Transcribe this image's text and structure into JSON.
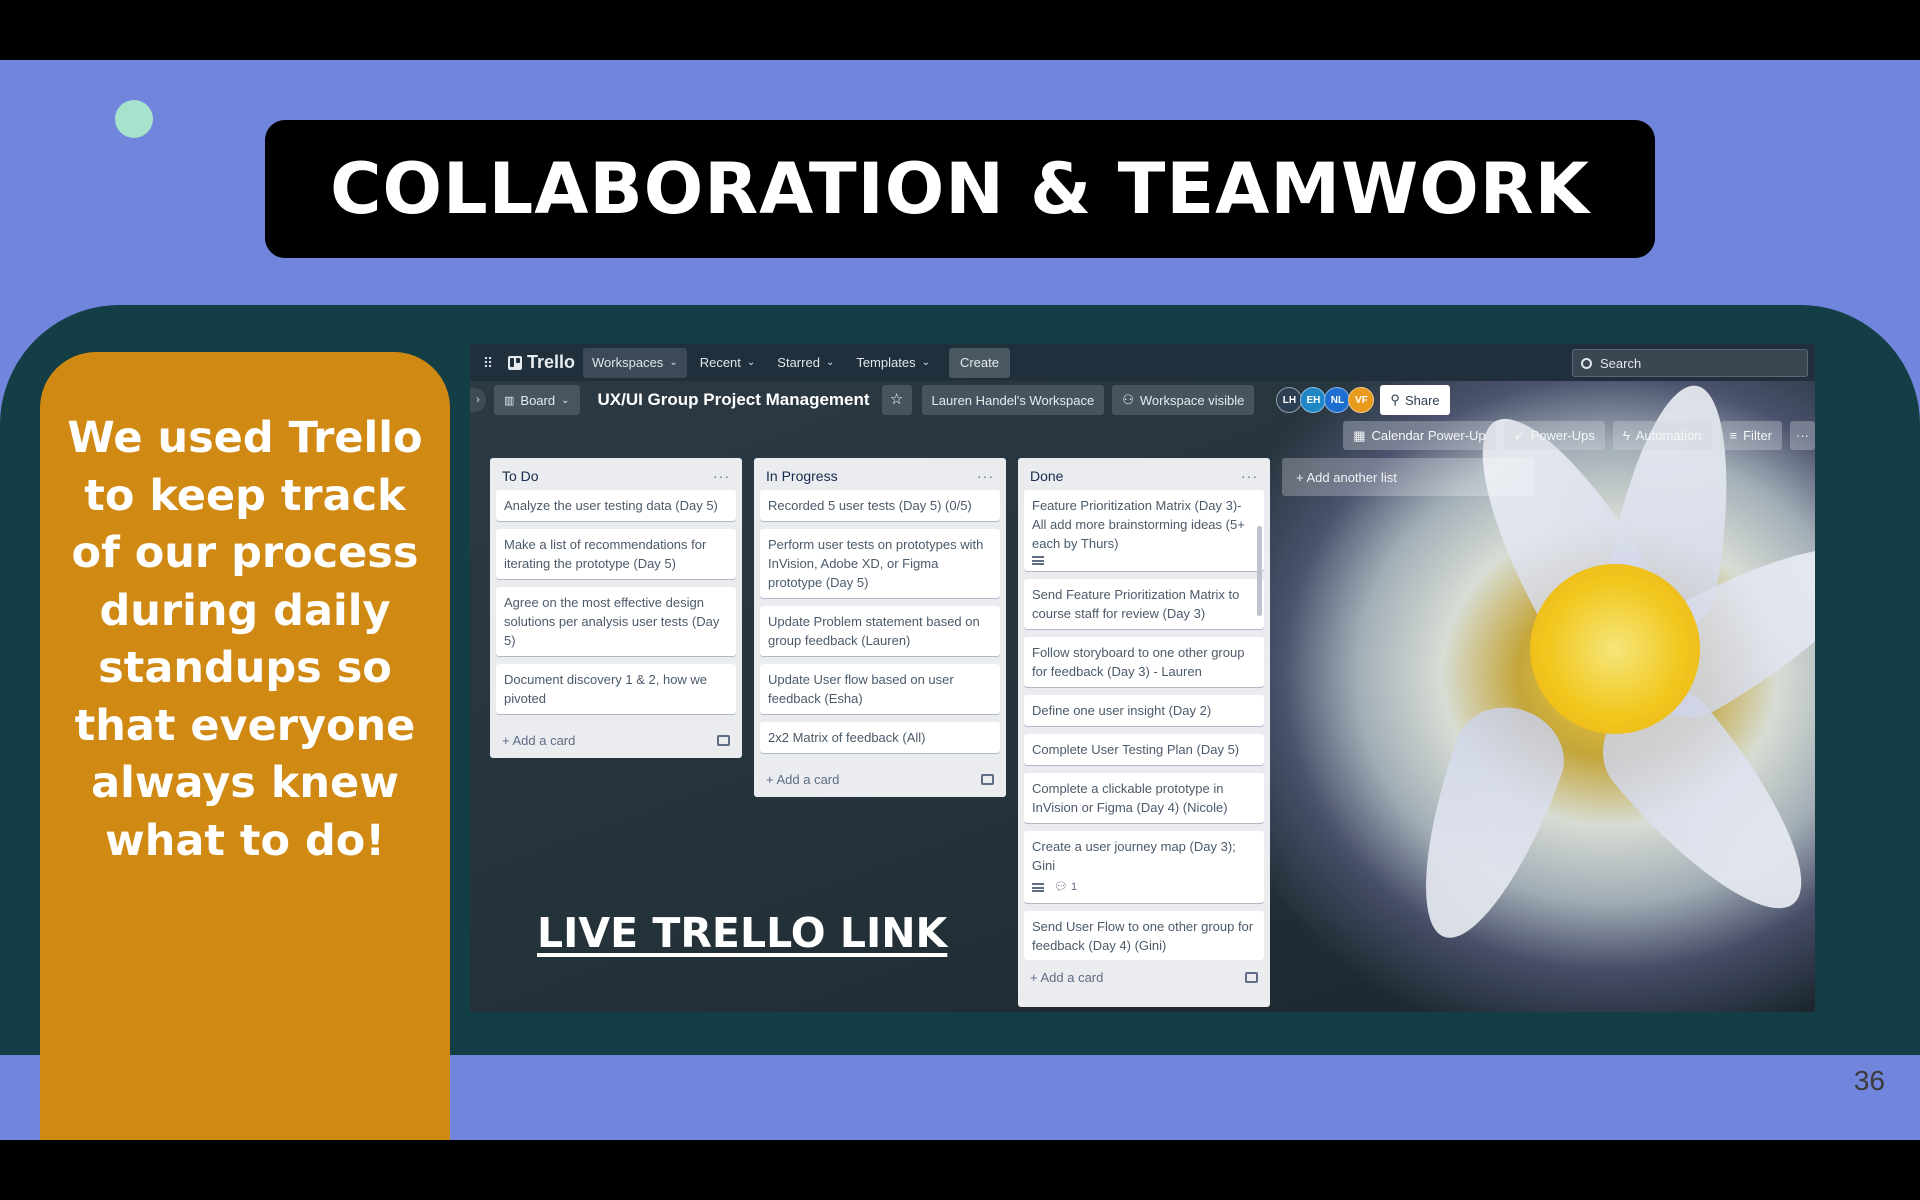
{
  "slide": {
    "title": "COLLABORATION & TEAMWORK",
    "body_text": "We used Trello to keep track of our process during daily standups so that everyone always knew what to do!",
    "page_number": "36",
    "link_text": "LIVE TRELLO LINK",
    "colors": {
      "background": "#7285dd",
      "panel": "#133e45",
      "callout": "#d08a14",
      "title_box": "#000000",
      "accent_dot": "#a6e3cc"
    }
  },
  "trello": {
    "top_nav": {
      "apps_icon": "grid-icon",
      "logo_text": "Trello",
      "items": [
        {
          "label": "Workspaces",
          "chevron": "⌄"
        },
        {
          "label": "Recent",
          "chevron": "⌄"
        },
        {
          "label": "Starred",
          "chevron": "⌄"
        },
        {
          "label": "Templates",
          "chevron": "⌄"
        }
      ],
      "create_label": "Create",
      "search_placeholder": "Search"
    },
    "board_header": {
      "view_label": "Board",
      "title": "UX/UI Group Project Management",
      "workspace_label": "Lauren Handel's Workspace",
      "visibility_label": "Workspace visible",
      "members": [
        {
          "initials": "LH",
          "color": "#2d3f52"
        },
        {
          "initials": "EH",
          "color": "#1e88c7"
        },
        {
          "initials": "NL",
          "color": "#1c6fd1"
        },
        {
          "initials": "VF",
          "color": "#e89a1c"
        }
      ],
      "share_label": "Share"
    },
    "power_bar": {
      "calendar_label": "Calendar Power-Up",
      "powerups_label": "Power-Ups",
      "automation_label": "Automation",
      "filter_label": "Filter",
      "more_label": "···"
    },
    "lists": [
      {
        "name": "To Do",
        "cards": [
          {
            "text": "Analyze the user testing data (Day 5)"
          },
          {
            "text": "Make a list of recommendations for iterating the prototype (Day 5)"
          },
          {
            "text": "Agree on the most effective design solutions per analysis user tests (Day 5)"
          },
          {
            "text": "Document discovery 1 & 2, how we pivoted"
          }
        ],
        "add_label": "+ Add a card"
      },
      {
        "name": "In Progress",
        "cards": [
          {
            "text": "Recorded 5 user tests (Day 5) (0/5)"
          },
          {
            "text": "Perform user tests on prototypes with InVision, Adobe XD, or Figma prototype (Day 5)"
          },
          {
            "text": "Update Problem statement based on group feedback (Lauren)"
          },
          {
            "text": "Update User flow based on user feedback (Esha)"
          },
          {
            "text": "2x2 Matrix of feedback (All)"
          }
        ],
        "add_label": "+ Add a card"
      },
      {
        "name": "Done",
        "cards": [
          {
            "text": "Feature Prioritization Matrix (Day 3)- All add more brainstorming ideas (5+ each by Thurs)",
            "has_description": true
          },
          {
            "text": "Send Feature Prioritization Matrix to course staff for review (Day 3)"
          },
          {
            "text": "Follow storyboard to one other group for feedback (Day 3) - Lauren"
          },
          {
            "text": "Define one user insight (Day 2)"
          },
          {
            "text": "Complete User Testing Plan (Day 5)"
          },
          {
            "text": "Complete a clickable prototype in InVision or Figma (Day 4) (Nicole)"
          },
          {
            "text": "Create a user journey map (Day 3); Gini",
            "has_description": true,
            "comments": "1"
          },
          {
            "text": "Send User Flow to one other group for feedback (Day 4) (Gini)"
          }
        ],
        "add_label": "+ Add a card"
      }
    ],
    "add_list_label": "+ Add another list"
  }
}
